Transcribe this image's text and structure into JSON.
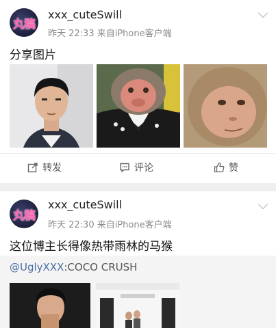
{
  "posts": [
    {
      "username": "xxx_cuteSwill",
      "avatar_text": "丸稿",
      "meta": "昨天 22:33  来自iPhone客户端",
      "text": "分享图片",
      "images": [
        "young-man-portrait",
        "monkey-in-suit",
        "monkey-face"
      ],
      "actions": {
        "repost": "转发",
        "comment": "评论",
        "like": "赞"
      }
    },
    {
      "username": "xxx_cuteSwill",
      "avatar_text": "丸稿",
      "meta": "昨天 22:30  来自iPhone客户端",
      "text": "这位博主长得像热带雨林的马猴",
      "quote": {
        "mention": "@UglyXXX",
        "text": ":COCO CRUSH"
      },
      "images": [
        "man-eating-photo",
        "chanel-store-photo"
      ]
    }
  ]
}
